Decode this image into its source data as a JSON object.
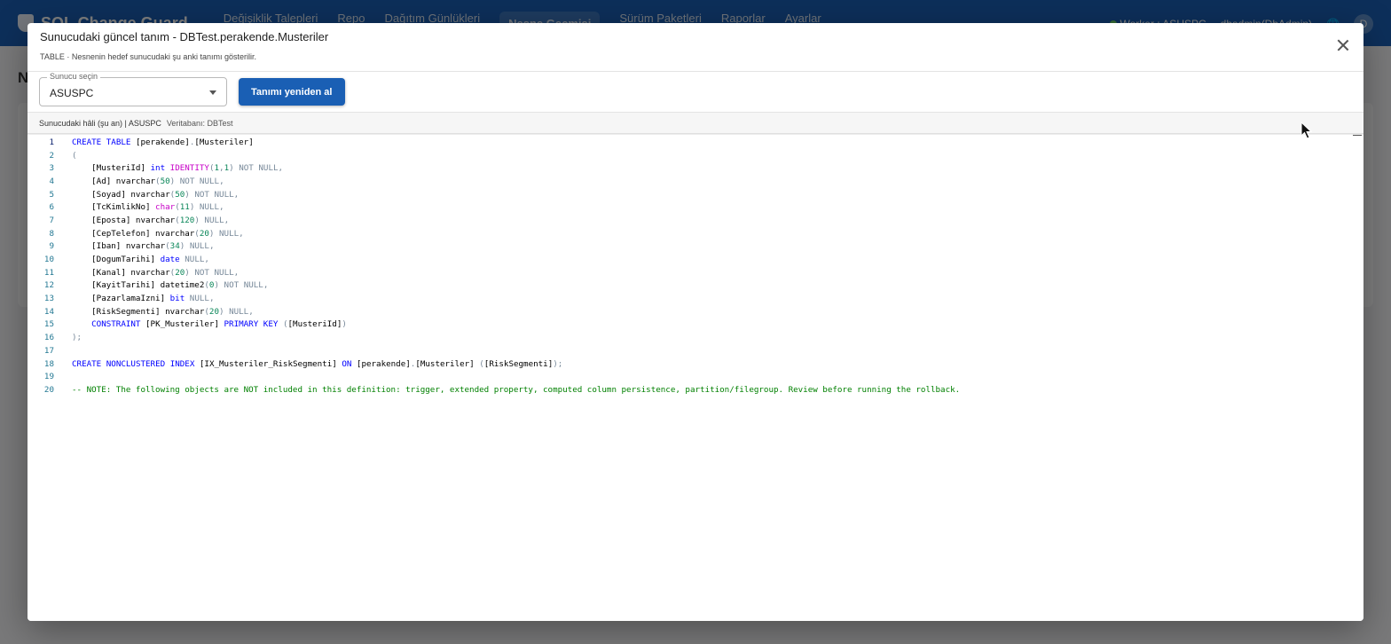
{
  "app": {
    "logo_text": "SQL Change Guard",
    "page_letter": "N",
    "nav": [
      "Değişiklik Talepleri",
      "Repo",
      "Dağıtım Günlükleri",
      "Nesne Geçmişi",
      "Sürüm Paketleri",
      "Raporlar",
      "Ayarlar"
    ],
    "worker_status": "Worker : ASUSPC",
    "user": "dbadmin(DbAdmin)",
    "avatar_initial": "D"
  },
  "modal": {
    "title": "Sunucudaki güncel tanım - DBTest.perakende.Musteriler",
    "subtitle": "TABLE · Nesnenin hedef sunucudaki şu anki tanımı gösterilir.",
    "server_select_label": "Sunucu seçin",
    "server_select_value": "ASUSPC",
    "reload_button": "Tanımı yeniden al",
    "info_main": "Sunucudaki hâli (şu an) | ASUSPC",
    "info_db": "Veritabanı: DBTest"
  },
  "code": [
    "CREATE TABLE [perakende].[Musteriler]",
    "(",
    "    [MusteriId] int IDENTITY(1,1) NOT NULL,",
    "    [Ad] nvarchar(50) NOT NULL,",
    "    [Soyad] nvarchar(50) NOT NULL,",
    "    [TcKimlikNo] char(11) NULL,",
    "    [Eposta] nvarchar(120) NULL,",
    "    [CepTelefon] nvarchar(20) NULL,",
    "    [Iban] nvarchar(34) NULL,",
    "    [DogumTarihi] date NULL,",
    "    [Kanal] nvarchar(20) NOT NULL,",
    "    [KayitTarihi] datetime2(0) NOT NULL,",
    "    [PazarlamaIzni] bit NULL,",
    "    [RiskSegmenti] nvarchar(20) NULL,",
    "    CONSTRAINT [PK_Musteriler] PRIMARY KEY ([MusteriId])",
    ");",
    "",
    "CREATE NONCLUSTERED INDEX [IX_Musteriler_RiskSegmenti] ON [perakende].[Musteriler] ([RiskSegmenti]);",
    "",
    "-- NOTE: The following objects are NOT included in this definition: trigger, extended property, computed column persistence, partition/filegroup. Review before running the rollback."
  ],
  "colors": {
    "primary": "#1a5fb4",
    "line_number": "#237893",
    "keyword": "#0000ff",
    "function": "#c700c7",
    "operator": "#778899",
    "number": "#098658",
    "comment": "#008000"
  }
}
